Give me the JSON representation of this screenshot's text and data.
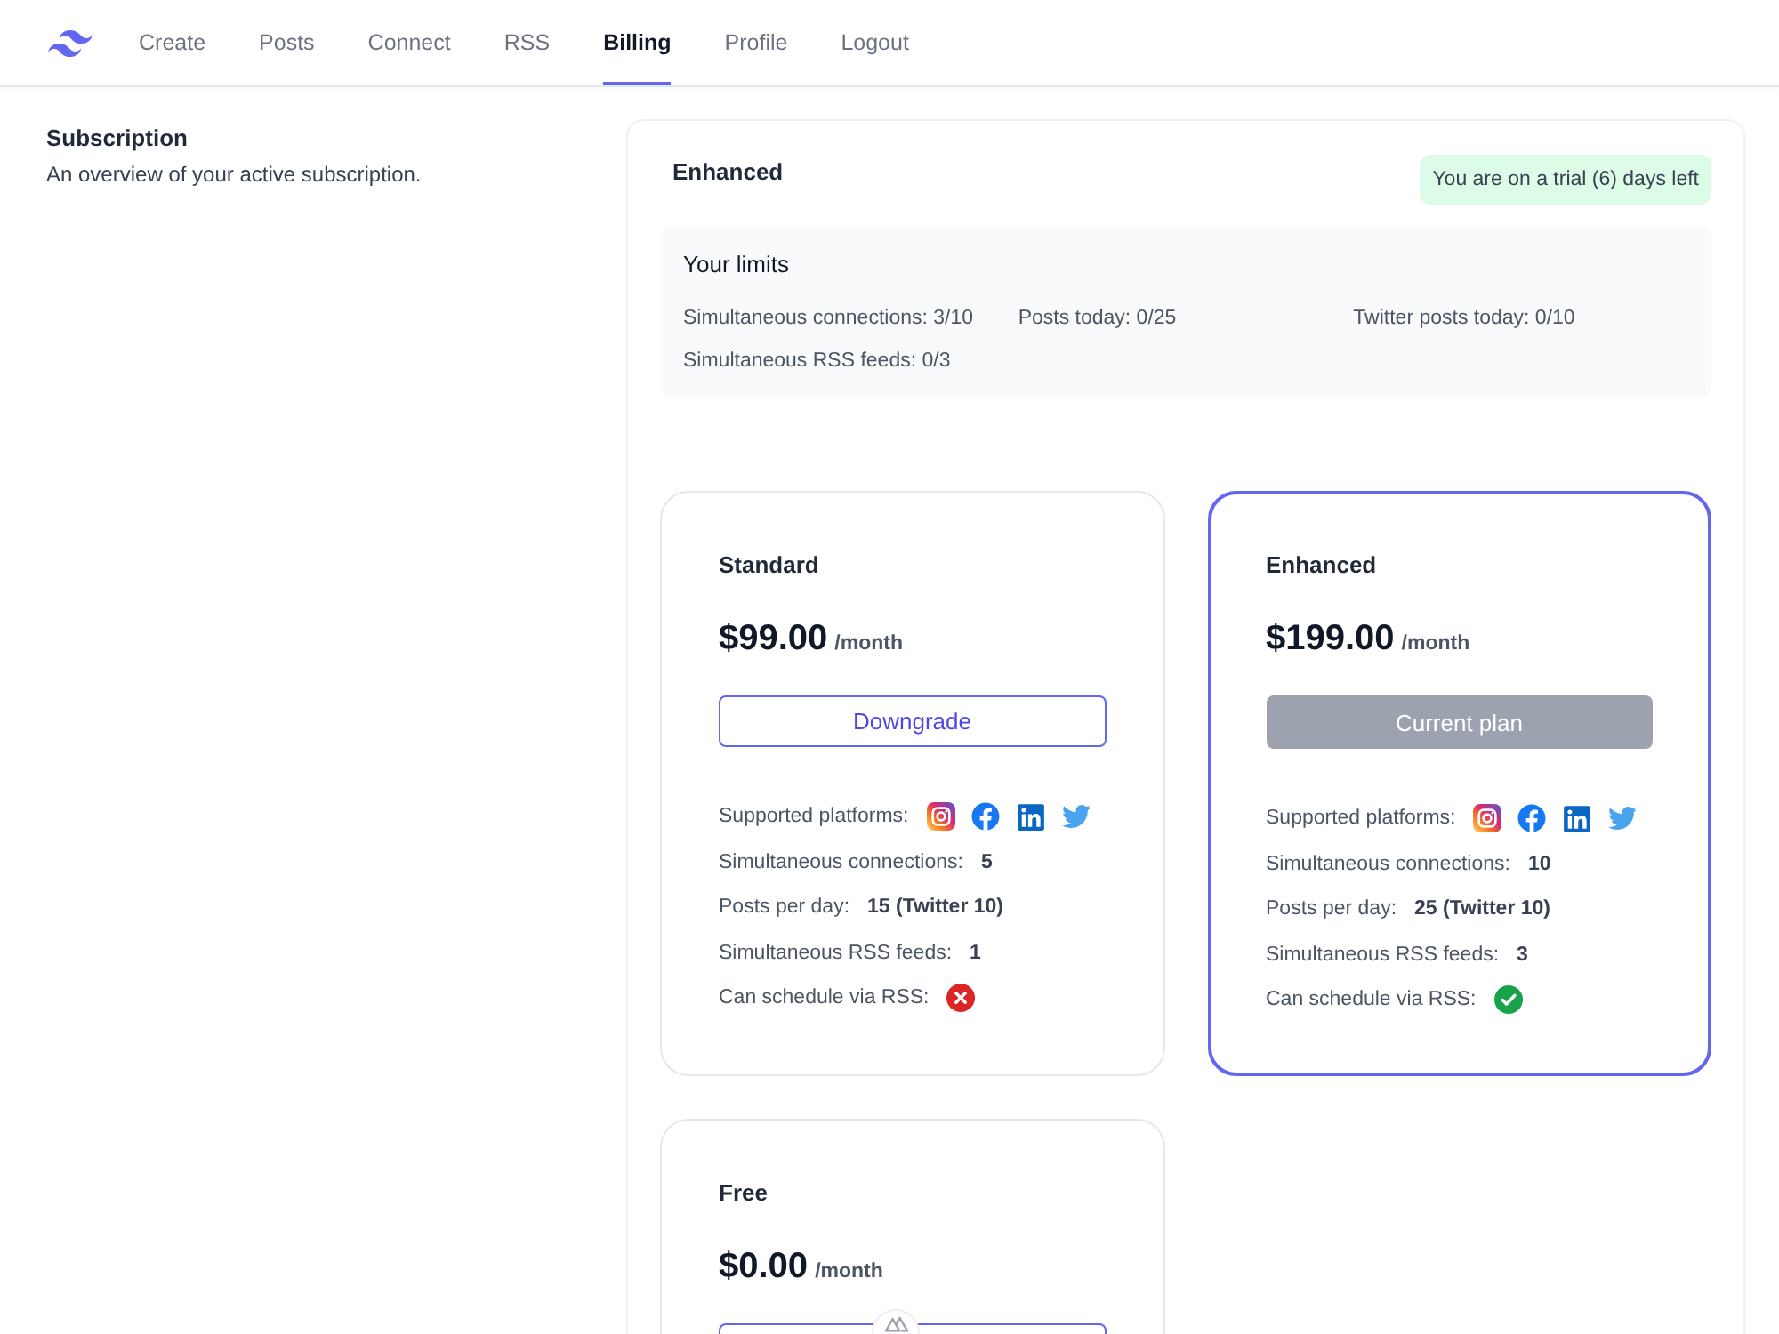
{
  "nav": {
    "items": [
      {
        "label": "Create",
        "selected": false
      },
      {
        "label": "Posts",
        "selected": false
      },
      {
        "label": "Connect",
        "selected": false
      },
      {
        "label": "RSS",
        "selected": false
      },
      {
        "label": "Billing",
        "selected": true
      },
      {
        "label": "Profile",
        "selected": false
      },
      {
        "label": "Logout",
        "selected": false
      }
    ]
  },
  "section": {
    "title": "Subscription",
    "description": "An overview of your active subscription."
  },
  "subscription": {
    "plan_name": "Enhanced",
    "trial_badge": "You are on a trial (6) days left",
    "limits": {
      "title": "Your limits",
      "items": [
        "Simultaneous connections: 3/10",
        "Posts today: 0/25",
        "Twitter posts today: 0/10",
        "Simultaneous RSS feeds: 0/3"
      ]
    }
  },
  "plans": [
    {
      "name": "Standard",
      "price": "$99.00",
      "period": "/month",
      "current": false,
      "button": {
        "label": "Downgrade",
        "disabled": false
      },
      "features": [
        {
          "kind": "platforms",
          "label": "Supported platforms:"
        },
        {
          "kind": "value",
          "label": "Simultaneous connections:",
          "value": "5"
        },
        {
          "kind": "value",
          "label": "Posts per day:",
          "value": "15 (Twitter 10)"
        },
        {
          "kind": "value",
          "label": "Simultaneous RSS feeds:",
          "value": "1"
        },
        {
          "kind": "check",
          "label": "Can schedule via RSS:",
          "available": false
        }
      ]
    },
    {
      "name": "Enhanced",
      "price": "$199.00",
      "period": "/month",
      "current": true,
      "button": {
        "label": "Current plan",
        "disabled": true
      },
      "features": [
        {
          "kind": "platforms",
          "label": "Supported platforms:"
        },
        {
          "kind": "value",
          "label": "Simultaneous connections:",
          "value": "10"
        },
        {
          "kind": "value",
          "label": "Posts per day:",
          "value": "25 (Twitter 10)"
        },
        {
          "kind": "value",
          "label": "Simultaneous RSS feeds:",
          "value": "3"
        },
        {
          "kind": "check",
          "label": "Can schedule via RSS:",
          "available": true
        }
      ]
    },
    {
      "name": "Free",
      "price": "$0.00",
      "period": "/month",
      "current": false,
      "button": {
        "disabled": false
      }
    }
  ]
}
